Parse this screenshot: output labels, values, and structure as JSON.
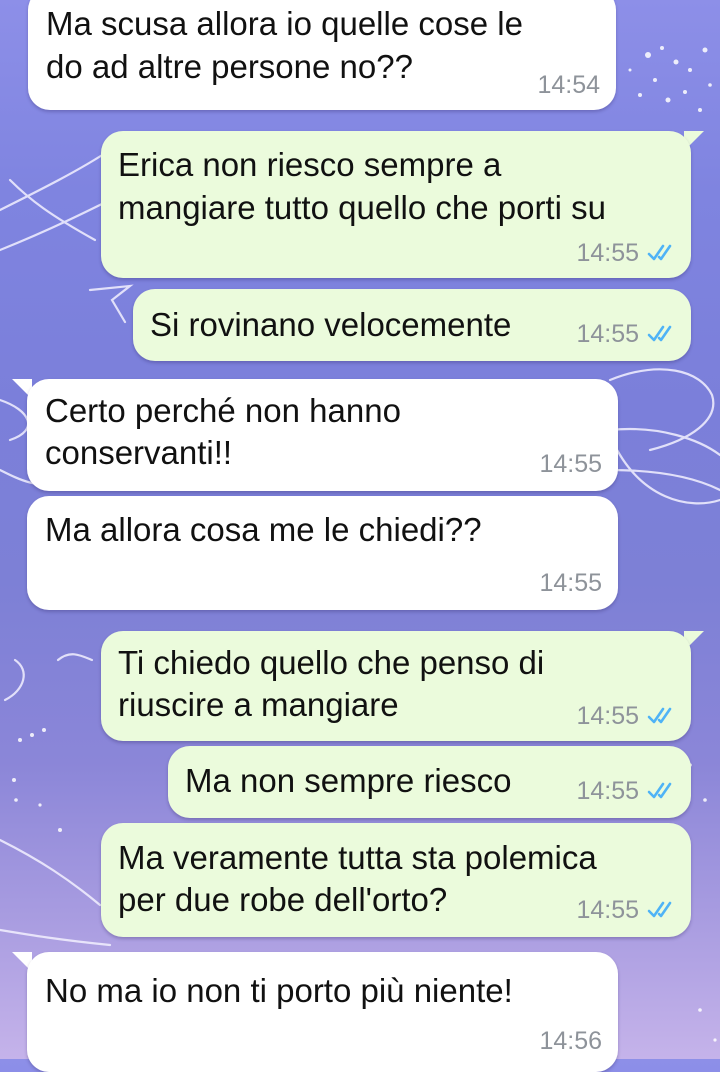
{
  "messages": [
    {
      "direction": "incoming",
      "lines": [
        "Ma scusa allora io quelle cose le",
        "do ad altre persone no??"
      ],
      "time": "14:54"
    },
    {
      "direction": "outgoing",
      "lines": [
        "Erica non riesco sempre a",
        "mangiare tutto quello che porti su"
      ],
      "time": "14:55",
      "read": true
    },
    {
      "direction": "outgoing",
      "lines": [
        "Si rovinano velocemente"
      ],
      "time": "14:55",
      "read": true
    },
    {
      "direction": "incoming",
      "lines": [
        "Certo perché non hanno",
        "conservanti!!"
      ],
      "time": "14:55"
    },
    {
      "direction": "incoming",
      "lines": [
        "Ma allora cosa me le chiedi??"
      ],
      "time": "14:55"
    },
    {
      "direction": "outgoing",
      "lines": [
        "Ti chiedo quello che penso di",
        "riuscire a mangiare"
      ],
      "time": "14:55",
      "read": true
    },
    {
      "direction": "outgoing",
      "lines": [
        "Ma non sempre riesco"
      ],
      "time": "14:55",
      "read": true
    },
    {
      "direction": "outgoing",
      "lines": [
        "Ma veramente tutta sta polemica",
        "per due robe dell'orto?"
      ],
      "time": "14:55",
      "read": true
    },
    {
      "direction": "incoming",
      "lines": [
        "No ma io non ti porto più niente!"
      ],
      "time": "14:56"
    }
  ],
  "colors": {
    "incoming_bubble": "#ffffff",
    "outgoing_bubble": "#ebfbdc",
    "timestamp": "#8e939a",
    "read_ticks": "#4fb3f6",
    "wallpaper": "#7d80d8"
  },
  "icons": {
    "read_receipt": "double-check-icon"
  }
}
